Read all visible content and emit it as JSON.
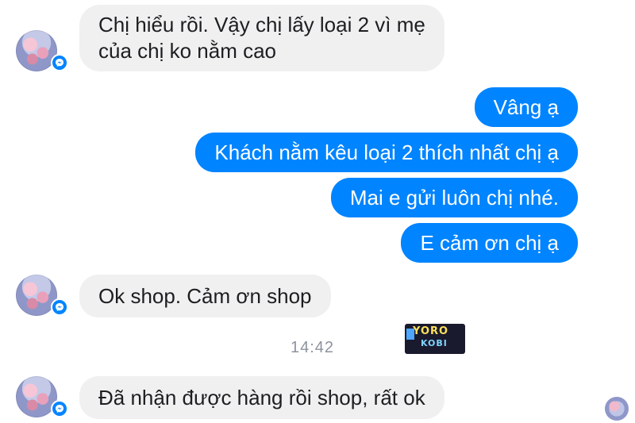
{
  "conversation": {
    "messages": [
      {
        "side": "incoming",
        "text": "Chị hiểu rồi. Vậy chị lấy loại 2 vì mẹ\ncủa chị ko nằm cao"
      },
      {
        "side": "outgoing",
        "text": "Vâng ạ"
      },
      {
        "side": "outgoing",
        "text": "Khách nằm kêu loại 2 thích nhất chị ạ"
      },
      {
        "side": "outgoing",
        "text": "Mai e gửi luôn chị nhé."
      },
      {
        "side": "outgoing",
        "text": "E cảm ơn chị ạ"
      },
      {
        "side": "incoming",
        "text": "Ok shop. Cảm ơn shop"
      },
      {
        "side": "incoming",
        "text": "Đã nhận được hàng rồi shop, rất ok"
      }
    ],
    "timestamp": "14:42",
    "colors": {
      "incoming_bubble": "#f1f0f0",
      "outgoing_bubble": "#0084ff",
      "messenger_badge": "#0084ff"
    }
  },
  "watermark": {
    "line1": "YORO",
    "line2": "KOBI"
  }
}
